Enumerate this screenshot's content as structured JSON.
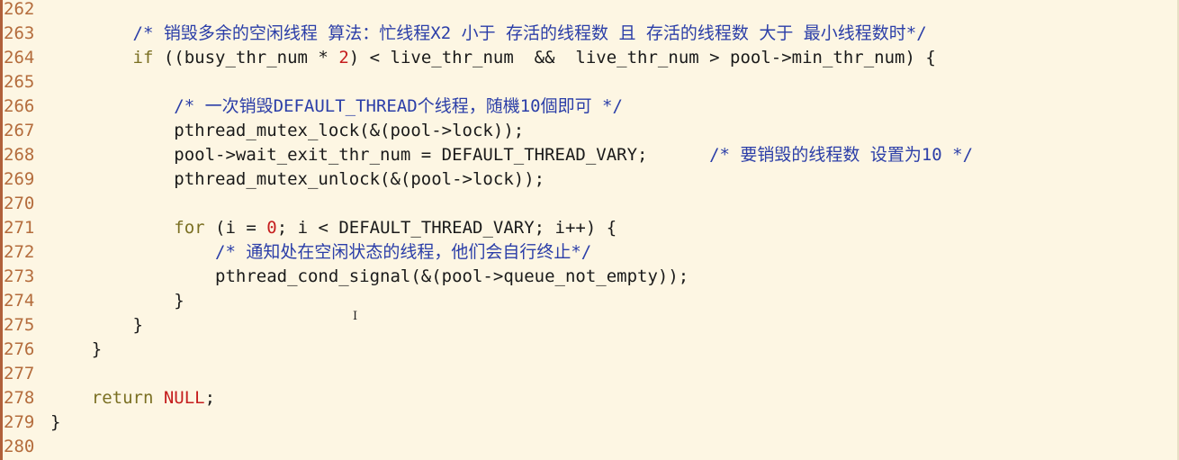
{
  "editor": {
    "colors": {
      "background": "#fdf6e3",
      "line_number": "#b46c3c",
      "keyword": "#7a6f22",
      "comment": "#2b3ea8",
      "literal": "#c51e1e",
      "text": "#1a1a1a"
    },
    "lines": [
      {
        "n": "262",
        "parts": []
      },
      {
        "n": "263",
        "parts": [
          {
            "t": "        ",
            "c": ""
          },
          {
            "t": "/* 销毁多余的空闲线程 算法：忙线程X2 小于 存活的线程数 且 存活的线程数 大于 最小线程数时*/",
            "c": "cm"
          }
        ]
      },
      {
        "n": "264",
        "parts": [
          {
            "t": "        ",
            "c": ""
          },
          {
            "t": "if",
            "c": "kw"
          },
          {
            "t": " ((busy_thr_num * ",
            "c": ""
          },
          {
            "t": "2",
            "c": "num"
          },
          {
            "t": ") < live_thr_num  &&  live_thr_num > pool->min_thr_num) {",
            "c": ""
          }
        ]
      },
      {
        "n": "265",
        "parts": []
      },
      {
        "n": "266",
        "parts": [
          {
            "t": "            ",
            "c": ""
          },
          {
            "t": "/* 一次销毁DEFAULT_THREAD个线程，随機10個即可 */",
            "c": "cm"
          }
        ]
      },
      {
        "n": "267",
        "parts": [
          {
            "t": "            pthread_mutex_lock(&(pool->lock));",
            "c": ""
          }
        ]
      },
      {
        "n": "268",
        "parts": [
          {
            "t": "            pool->wait_exit_thr_num = DEFAULT_THREAD_VARY;      ",
            "c": ""
          },
          {
            "t": "/* 要销毁的线程数 设置为10 */",
            "c": "cm"
          }
        ]
      },
      {
        "n": "269",
        "parts": [
          {
            "t": "            pthread_mutex_unlock(&(pool->lock));",
            "c": ""
          }
        ]
      },
      {
        "n": "270",
        "parts": []
      },
      {
        "n": "271",
        "parts": [
          {
            "t": "            ",
            "c": ""
          },
          {
            "t": "for",
            "c": "kw"
          },
          {
            "t": " (i = ",
            "c": ""
          },
          {
            "t": "0",
            "c": "num"
          },
          {
            "t": "; i < DEFAULT_THREAD_VARY; i++) {",
            "c": ""
          }
        ]
      },
      {
        "n": "272",
        "parts": [
          {
            "t": "                ",
            "c": ""
          },
          {
            "t": "/* 通知处在空闲状态的线程，他们会自行终止*/",
            "c": "cm"
          }
        ]
      },
      {
        "n": "273",
        "parts": [
          {
            "t": "                pthread_cond_signal(&(pool->queue_not_empty));",
            "c": ""
          }
        ]
      },
      {
        "n": "274",
        "parts": [
          {
            "t": "            }",
            "c": ""
          }
        ]
      },
      {
        "n": "275",
        "parts": [
          {
            "t": "        }",
            "c": ""
          }
        ]
      },
      {
        "n": "276",
        "parts": [
          {
            "t": "    }",
            "c": ""
          }
        ]
      },
      {
        "n": "277",
        "parts": []
      },
      {
        "n": "278",
        "parts": [
          {
            "t": "    ",
            "c": ""
          },
          {
            "t": "return",
            "c": "kw"
          },
          {
            "t": " ",
            "c": ""
          },
          {
            "t": "NULL",
            "c": "nul"
          },
          {
            "t": ";",
            "c": ""
          }
        ]
      },
      {
        "n": "279",
        "parts": [
          {
            "t": "}",
            "c": ""
          }
        ]
      },
      {
        "n": "280",
        "parts": []
      }
    ],
    "mouse_cursor_icon": "text-cursor-icon",
    "mouse_cursor_glyph": "I"
  }
}
